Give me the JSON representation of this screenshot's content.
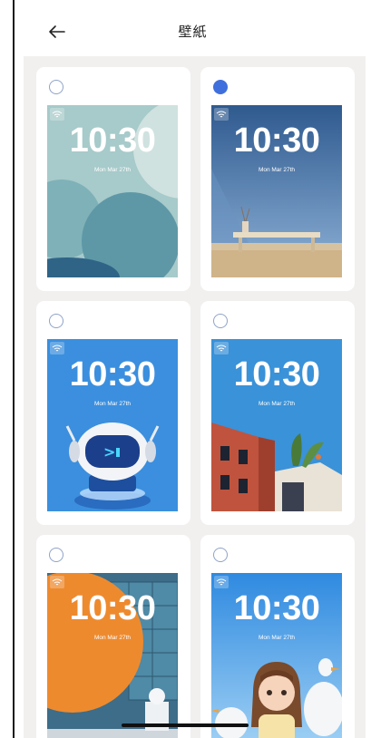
{
  "header": {
    "title": "壁紙"
  },
  "wallpapers": [
    {
      "selected": false,
      "time": "10:30",
      "date": "Mon Mar 27th"
    },
    {
      "selected": true,
      "time": "10:30",
      "date": "Mon Mar 27th"
    },
    {
      "selected": false,
      "time": "10:30",
      "date": "Mon Mar 27th"
    },
    {
      "selected": false,
      "time": "10:30",
      "date": "Mon Mar 27th"
    },
    {
      "selected": false,
      "time": "10:30",
      "date": "Mon Mar 27th"
    },
    {
      "selected": false,
      "time": "10:30",
      "date": "Mon Mar 27th"
    }
  ],
  "colors": {
    "accent": "#3f6fdc",
    "background": "#f2f0ef"
  }
}
